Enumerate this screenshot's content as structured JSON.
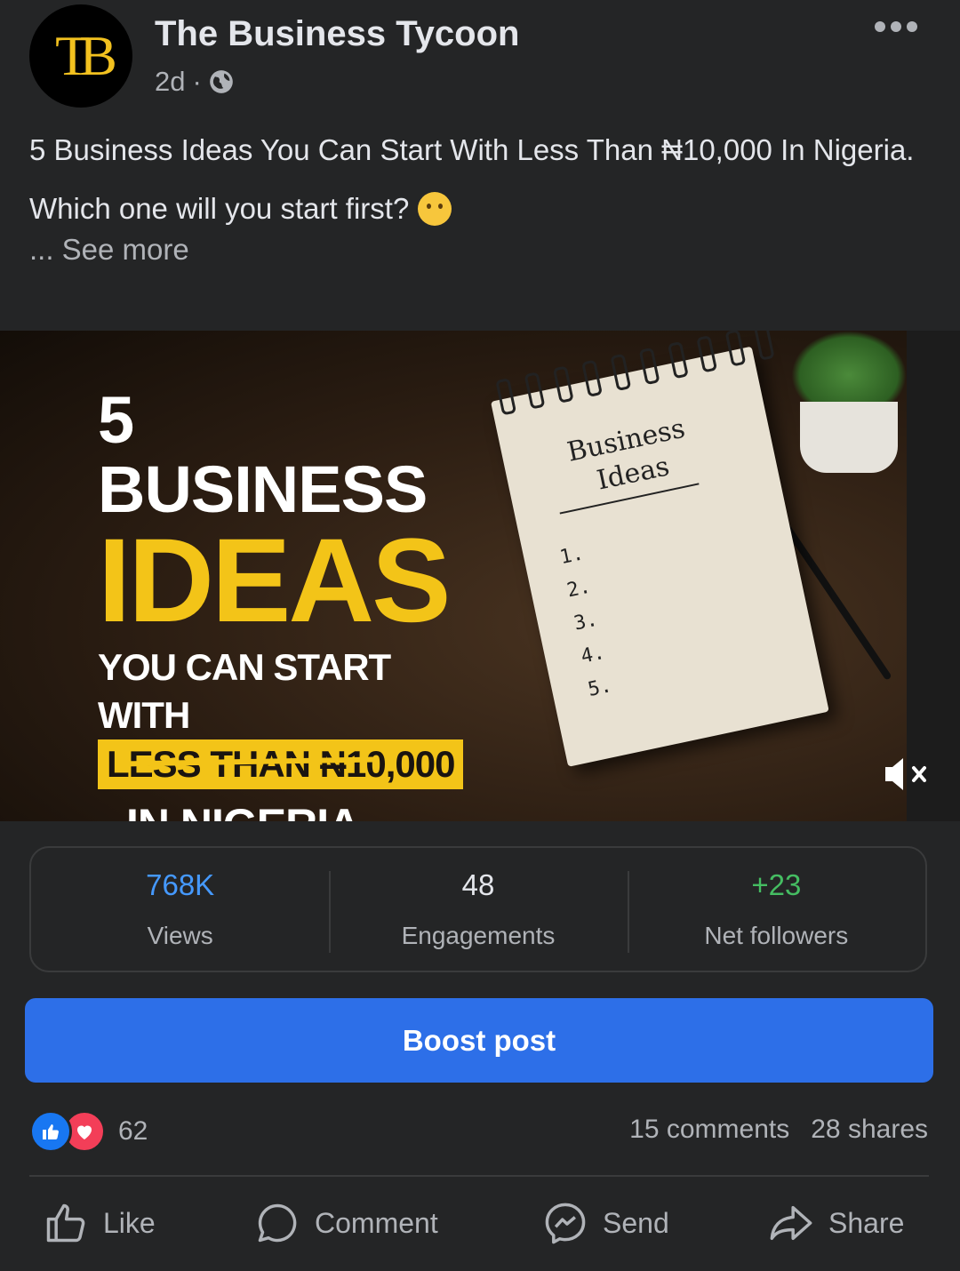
{
  "post": {
    "page_name": "The Business Tycoon",
    "avatar_text": "TB",
    "time": "2d",
    "separator": "·",
    "caption_line1": "5 Business Ideas You Can Start With Less Than ₦10,000 In Nigeria.",
    "caption_line2": "Which one will you start first?",
    "caption_emoji": "thinking-face-icon",
    "see_more": "... See more"
  },
  "media": {
    "headline_1": "5 BUSINESS",
    "headline_2": "IDEAS",
    "headline_3": "YOU CAN START WITH",
    "headline_4": "LESS THAN ₦10,000",
    "headline_5": "IN NIGERIA",
    "notepad_title": "Business Ideas",
    "notepad_items": [
      "1.",
      "2.",
      "3.",
      "4.",
      "5."
    ],
    "mute_icon": "speaker-muted-icon"
  },
  "stats": {
    "views_value": "768K",
    "views_label": "Views",
    "engagements_value": "48",
    "engagements_label": "Engagements",
    "followers_value": "+23",
    "followers_label": "Net followers"
  },
  "boost_label": "Boost post",
  "reactions": {
    "count": "62",
    "comments": "15 comments",
    "shares": "28 shares"
  },
  "actions": {
    "like": "Like",
    "comment": "Comment",
    "send": "Send",
    "share": "Share"
  },
  "colors": {
    "background": "#242526",
    "accent_blue": "#2d6fe8",
    "views_blue": "#4599ff",
    "followers_green": "#45bd62",
    "headline_yellow": "#f3c418"
  }
}
